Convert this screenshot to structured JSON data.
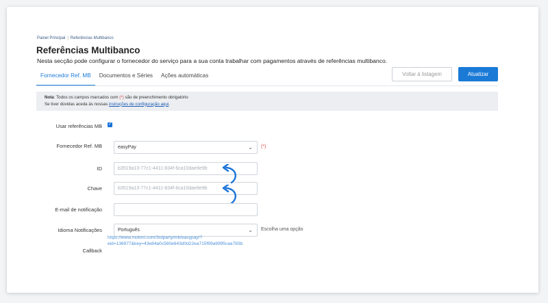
{
  "breadcrumb": {
    "home": "Painel Principal",
    "current": "Referências Multibanco"
  },
  "page": {
    "title": "Referências Multibanco",
    "subtitle": "Nesta secção pode configurar o fornecedor do serviço para a sua conta trabalhar com pagamentos através de referências multibanco."
  },
  "tabs": [
    "Fornecedor Ref. MB",
    "Documentos e Séries",
    "Ações automáticas"
  ],
  "buttons": {
    "back": "Voltar à listagem",
    "update": "Atualizar"
  },
  "notice": {
    "note_label": "Nota",
    "line1_a": ": Todos os campos marcados com ",
    "req": "(*)",
    "line1_b": " são de preenchimento obrigatório",
    "line2_a": "Se tiver dúvidas aceda às nossas ",
    "line2_link": "instruções de configuração aqui",
    "line2_b": "."
  },
  "form": {
    "use_label": "Usar referências MB",
    "provider_label": "Fornecedor Ref. MB",
    "provider_value": "easyPay",
    "required_mark": "(*)",
    "id_label": "ID",
    "id_value": "b3519a13-77c1-4411-834f-6ca10dae8e9b",
    "key_label": "Chave",
    "key_value": "b3519a13-77c1-4411-834f-6ca10dae8e9b",
    "email_label": "E-mail de notificação",
    "email_value": "",
    "language_label": "Idioma Notificações",
    "language_value": "Português",
    "language_hint": "Escolha uma opção",
    "callback_label": "Callback",
    "callback_line1": "https://www.moloni.com/3rdparty/mb/easypay/?",
    "callback_line2": "eid=136977&key=43e84a0c580e643d0d22ea715f99a9995caa783b"
  },
  "colors": {
    "accent": "#1a7ad6",
    "required": "#e04a4a",
    "arrow": "#1a73d9"
  }
}
